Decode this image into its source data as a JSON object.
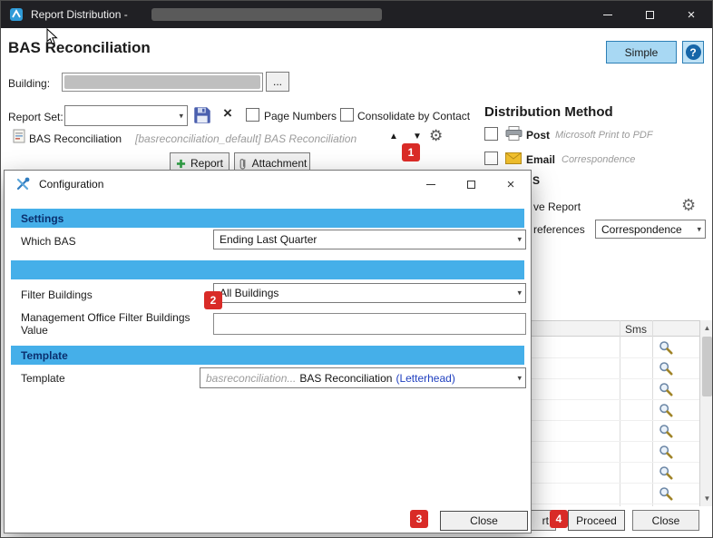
{
  "colors": {
    "titlebar_bg": "#202024",
    "section_band": "#45afe9",
    "badge_red": "#d92b27",
    "simple_button_bg": "#a8d8f3"
  },
  "window": {
    "title": "Report Distribution -"
  },
  "header": {
    "title": "BAS Reconciliation",
    "simple_button": "Simple",
    "help": "?"
  },
  "building": {
    "label": "Building:",
    "browse": "..."
  },
  "report_set": {
    "label": "Report Set:",
    "page_numbers": "Page Numbers",
    "consolidate": "Consolidate by Contact"
  },
  "report_item": {
    "name": "BAS Reconciliation",
    "detail": "[basreconciliation_default] BAS Reconciliation",
    "add_report": "Report",
    "attachment": "Attachment"
  },
  "distribution": {
    "heading": "Distribution Method",
    "post": "Post",
    "post_detail": "Microsoft Print to PDF",
    "email": "Email",
    "email_detail": "Correspondence",
    "sms_partial": "S",
    "save_report_partial": "ve Report",
    "preferences_partial": "references",
    "preferences_value": "Correspondence"
  },
  "grid": {
    "sms_header": "Sms",
    "rows": 8
  },
  "footer": {
    "partial_button": "rt",
    "proceed": "Proceed",
    "close": "Close"
  },
  "dialog": {
    "title": "Configuration",
    "settings_header": "Settings",
    "which_bas_label": "Which BAS",
    "which_bas_value": "Ending Last Quarter",
    "filter_label": "Filter Buildings",
    "filter_value": "All Buildings",
    "mgmt_label_line1": "Management Office Filter Buildings",
    "mgmt_label_line2": "Value",
    "template_header": "Template",
    "template_label": "Template",
    "template_prefix": "basreconciliation...",
    "template_name": "BAS Reconciliation",
    "template_suffix": "(Letterhead)",
    "close": "Close"
  },
  "badges": {
    "b1": "1",
    "b2": "2",
    "b3": "3",
    "b4": "4"
  }
}
